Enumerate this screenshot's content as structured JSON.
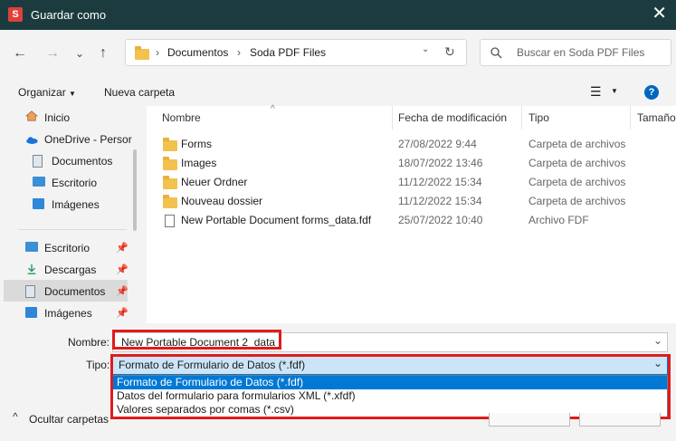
{
  "window": {
    "title": "Guardar como",
    "app_icon_letter": "S"
  },
  "nav": {
    "breadcrumb": [
      "Documentos",
      "Soda PDF Files"
    ],
    "search_placeholder": "Buscar en Soda PDF Files"
  },
  "toolbar": {
    "organize_label": "Organizar",
    "new_folder_label": "Nueva carpeta"
  },
  "sidebar": {
    "items": [
      {
        "label": "Inicio",
        "icon": "home-icon"
      },
      {
        "label": "OneDrive - Persor",
        "icon": "cloud-icon"
      },
      {
        "label": "Documentos",
        "icon": "documents-icon"
      },
      {
        "label": "Escritorio",
        "icon": "desktop-icon"
      },
      {
        "label": "Imágenes",
        "icon": "pictures-icon"
      }
    ],
    "quick_access": [
      {
        "label": "Escritorio",
        "icon": "desktop-icon"
      },
      {
        "label": "Descargas",
        "icon": "download-icon"
      },
      {
        "label": "Documentos",
        "icon": "documents-icon",
        "selected": true
      },
      {
        "label": "Imágenes",
        "icon": "pictures-icon"
      }
    ]
  },
  "files": {
    "columns": [
      "Nombre",
      "Fecha de modificación",
      "Tipo",
      "Tamaño"
    ],
    "rows": [
      {
        "name": "Forms",
        "date": "27/08/2022 9:44",
        "type": "Carpeta de archivos",
        "icon": "folder-icon"
      },
      {
        "name": "Images",
        "date": "18/07/2022 13:46",
        "type": "Carpeta de archivos",
        "icon": "folder-icon"
      },
      {
        "name": "Neuer Ordner",
        "date": "11/12/2022 15:34",
        "type": "Carpeta de archivos",
        "icon": "folder-icon"
      },
      {
        "name": "Nouveau dossier",
        "date": "11/12/2022 15:34",
        "type": "Carpeta de archivos",
        "icon": "folder-icon"
      },
      {
        "name": "New Portable Document forms_data.fdf",
        "date": "25/07/2022 10:40",
        "type": "Archivo FDF",
        "icon": "file-icon"
      }
    ]
  },
  "form": {
    "name_label": "Nombre:",
    "name_value": "New Portable Document 2_data",
    "type_label": "Tipo:",
    "type_value": "Formato de Formulario de Datos (*.fdf)",
    "type_options": [
      "Formato de Formulario de Datos (*.fdf)",
      "Datos del formulario para formularios XML (*.xfdf)",
      "Valores separados por comas (*.csv)"
    ],
    "hide_folders_label": "Ocultar carpetas"
  },
  "colors": {
    "title_bar": "#1c3b3e",
    "accent": "#0078d4",
    "highlight": "#e01b1b",
    "selected_option": "#0078d4"
  }
}
